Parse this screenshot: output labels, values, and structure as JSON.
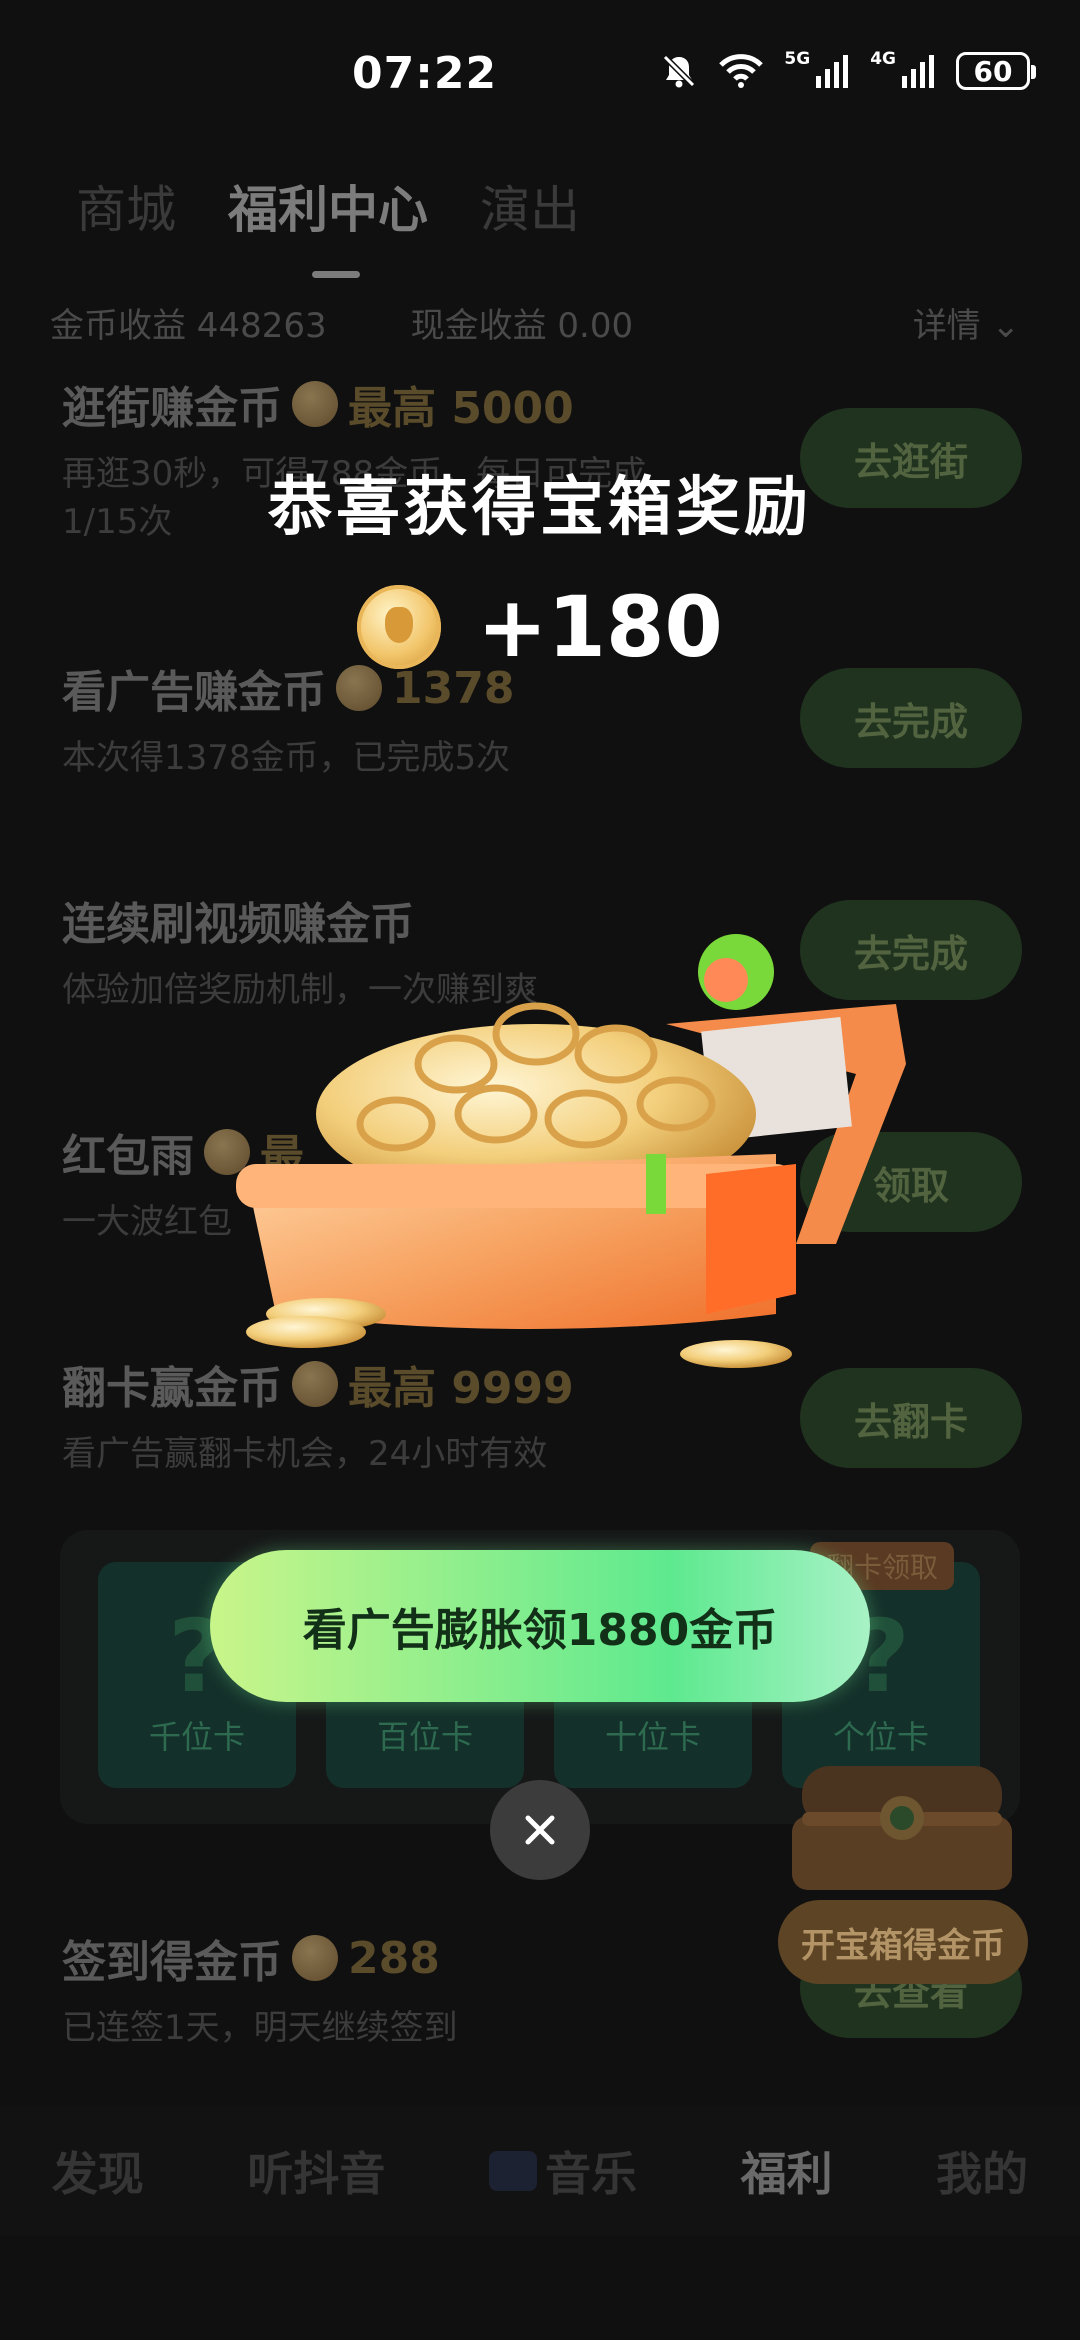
{
  "status_bar": {
    "time": "07:22",
    "network_5g": "5G",
    "network_4g": "4G",
    "battery": "60"
  },
  "tabs": [
    {
      "label": "商城"
    },
    {
      "label": "福利中心"
    },
    {
      "label": "演出"
    }
  ],
  "earnings": {
    "coins": "金币收益 448263",
    "cash": "现金收益 0.00",
    "detail": "详情"
  },
  "tasks": [
    {
      "title": "逛街赚金币",
      "reward": "最高 5000",
      "desc1": "再逛30秒，可得788金币，每日可完成",
      "desc2": "1/15次",
      "button": "去逛街"
    },
    {
      "title": "看广告赚金币",
      "reward": "1378",
      "desc1": "本次得1378金币，已完成5次",
      "button": "去完成"
    },
    {
      "title": "连续刷视频赚金币",
      "desc1": "体验加倍奖励机制，一次赚到爽",
      "button": "去完成"
    },
    {
      "title": "红包雨",
      "reward": "最",
      "desc1": "一大波红包",
      "button": "领取"
    },
    {
      "title": "翻卡赢金币",
      "reward": "最高 9999",
      "desc1": "看广告赢翻卡机会，24小时有效",
      "button": "去翻卡"
    },
    {
      "title": "签到得金币",
      "reward": "288",
      "desc1": "已连签1天，明天继续签到",
      "button": "去查看"
    }
  ],
  "cards": {
    "tag": "翻卡领取",
    "items": [
      {
        "symbol": "?",
        "label": "千位卡"
      },
      {
        "symbol": "?",
        "label": "百位卡"
      },
      {
        "symbol": "?",
        "label": "十位卡"
      },
      {
        "symbol": "?",
        "label": "个位卡"
      }
    ]
  },
  "floating_chest": {
    "label": "开宝箱得金币"
  },
  "bottom_nav": [
    {
      "label": "发现"
    },
    {
      "label": "听抖音"
    },
    {
      "label": "音乐"
    },
    {
      "label": "福利"
    },
    {
      "label": "我的"
    }
  ],
  "popup": {
    "title": "恭喜获得宝箱奖励",
    "amount": "+180",
    "cta": "看广告膨胀领1880金币"
  }
}
